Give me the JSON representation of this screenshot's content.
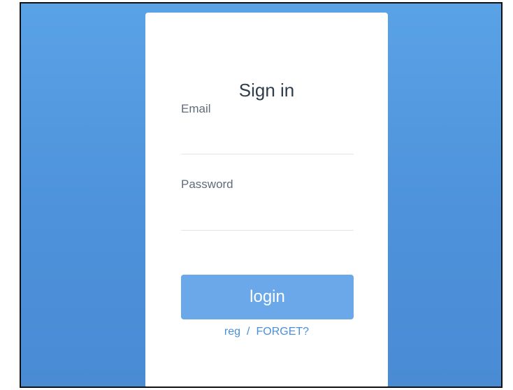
{
  "login_card": {
    "title": "Sign in",
    "email_label": "Email",
    "email_value": "",
    "password_label": "Password",
    "password_value": "",
    "login_label": "login",
    "register_link": "reg",
    "separator": "/",
    "forget_link": "FORGET?"
  },
  "colors": {
    "background": "#4d92db",
    "card": "#ffffff",
    "button": "#6aa8ea",
    "link": "#4a90d9",
    "title_text": "#2f3e4d",
    "label_text": "#606c7a"
  }
}
